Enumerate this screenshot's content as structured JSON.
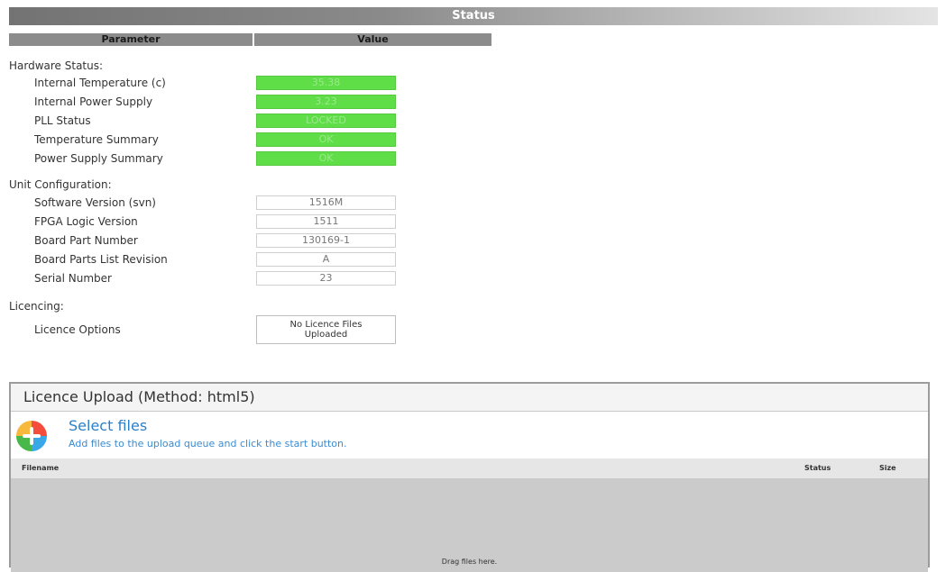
{
  "header": {
    "title": "Status"
  },
  "columns": {
    "parameter": "Parameter",
    "value": "Value"
  },
  "hardware": {
    "label": "Hardware Status:",
    "rows": [
      {
        "name": "Internal Temperature (c)",
        "value": "35.38"
      },
      {
        "name": "Internal Power Supply",
        "value": "3.23"
      },
      {
        "name": "PLL Status",
        "value": "LOCKED"
      },
      {
        "name": "Temperature Summary",
        "value": "OK"
      },
      {
        "name": "Power Supply Summary",
        "value": "OK"
      }
    ],
    "status_color": "#5fde47"
  },
  "unit": {
    "label": "Unit Configuration:",
    "rows": [
      {
        "name": "Software Version (svn)",
        "value": "1516M"
      },
      {
        "name": "FPGA Logic Version",
        "value": "1511"
      },
      {
        "name": "Board Part Number",
        "value": "130169-1"
      },
      {
        "name": "Board Parts List Revision",
        "value": "A"
      },
      {
        "name": "Serial Number",
        "value": "23"
      }
    ]
  },
  "licencing": {
    "label": "Licencing:",
    "option_name": "Licence Options",
    "option_value_line1": "No Licence Files",
    "option_value_line2": "Uploaded"
  },
  "upload": {
    "title": "Licence Upload (Method: html5)",
    "icon": "add-files-icon",
    "select_title": "Select files",
    "select_subtitle": "Add files to the upload queue and click the start button.",
    "col_filename": "Filename",
    "col_status": "Status",
    "col_size": "Size",
    "drop_text": "Drag files here."
  }
}
